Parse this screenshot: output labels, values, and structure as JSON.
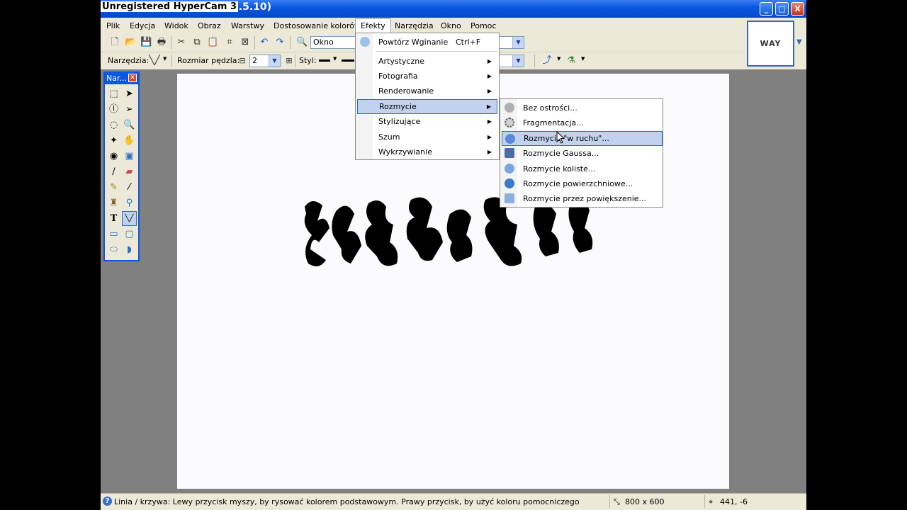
{
  "window": {
    "title": "Bez tytułu (Paint.NET v3.5.10)",
    "recorder_overlay": "Unregistered HyperCam 3",
    "caption_buttons": [
      "_",
      "□",
      "X"
    ]
  },
  "menubar": [
    "Plik",
    "Edycja",
    "Widok",
    "Obraz",
    "Warstwy",
    "Dostosowanie kolorów",
    "Efekty",
    "Narzędzia",
    "Okno",
    "Pomoc"
  ],
  "toolbar": {
    "zoom_value": "Okno",
    "tool_label": "Narzędzia:",
    "brush_size_label": "Rozmiar pędzla:",
    "brush_size_value": "2",
    "style_label": "Styl:"
  },
  "tools_window": {
    "title": "Nar..."
  },
  "thumbnail": {
    "text": "WAY"
  },
  "effects_menu": {
    "repeat_label": "Powtórz Wginanie",
    "repeat_shortcut": "Ctrl+F",
    "items": [
      "Artystyczne",
      "Fotografia",
      "Renderowanie",
      "Rozmycie",
      "Stylizujące",
      "Szum",
      "Wykrzywianie"
    ],
    "highlighted": "Rozmycie"
  },
  "blur_submenu": {
    "items": [
      "Bez ostrości...",
      "Fragmentacja...",
      "Rozmycie \"w ruchu\"...",
      "Rozmycie Gaussa...",
      "Rozmycie koliste...",
      "Rozmycie powierzchniowe...",
      "Rozmycie przez powiększenie..."
    ],
    "highlighted": "Rozmycie \"w ruchu\"..."
  },
  "statusbar": {
    "hint": "Linia / krzywa: Lewy przycisk myszy, by rysować kolorem podstawowym. Prawy przycisk, by użyć koloru pomocniczego",
    "image_size": "800 x 600",
    "cursor_pos": "441, -6"
  },
  "colors": {
    "titlebar": "#0a58e0",
    "menu_highlight": "#c1d2ee",
    "canvas_bg": "#808080"
  }
}
